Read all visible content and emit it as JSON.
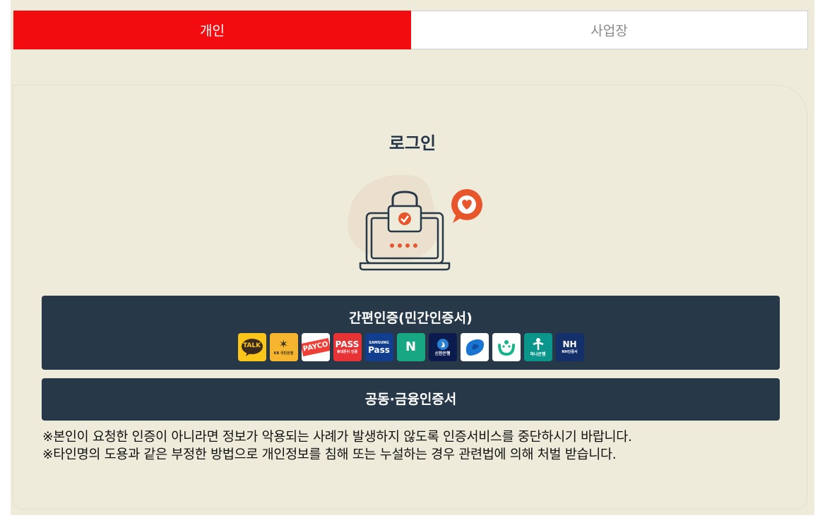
{
  "tabs": [
    {
      "label": "개인",
      "active": true
    },
    {
      "label": "사업장",
      "active": false
    }
  ],
  "login": {
    "title": "로그인"
  },
  "simple_auth": {
    "label": "간편인증(민간인증서)",
    "providers": [
      {
        "name": "kakao",
        "text": "TALK",
        "sub": ""
      },
      {
        "name": "kb",
        "text": "✶",
        "sub": "KB 국민은행"
      },
      {
        "name": "payco",
        "text": "PAYCO",
        "sub": ""
      },
      {
        "name": "pass",
        "text": "PASS",
        "sub": "휴대폰이 인증"
      },
      {
        "name": "samsung-pass",
        "text": "Pass",
        "sub": "SAMSUNG"
      },
      {
        "name": "naver",
        "text": "N",
        "sub": ""
      },
      {
        "name": "shinhan",
        "text": "",
        "sub": "신한은행"
      },
      {
        "name": "toss",
        "text": "",
        "sub": ""
      },
      {
        "name": "banksalad",
        "text": "",
        "sub": ""
      },
      {
        "name": "hana",
        "text": "",
        "sub": "하나은행"
      },
      {
        "name": "nh",
        "text": "NH",
        "sub": "NH인증서"
      }
    ]
  },
  "joint_auth": {
    "label": "공동·금융인증서"
  },
  "notices": [
    "※본인이 요청한 인증이 아니라면 정보가 악용되는 사례가 발생하지 않도록 인증서비스를 중단하시기 바랍니다.",
    "※타인명의 도용과 같은 부정한 방법으로 개인정보를 침해 또는 누설하는 경우 관련법에 의해 처벌 받습니다."
  ],
  "colors": {
    "accent_red": "#f20c0f",
    "button_navy": "#273849",
    "background": "#efebdb"
  }
}
